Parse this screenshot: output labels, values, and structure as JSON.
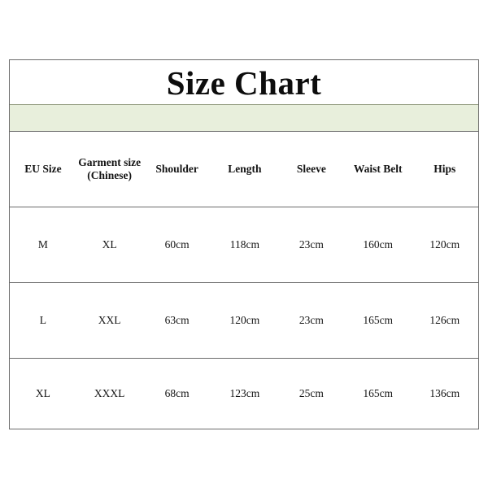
{
  "chart_data": {
    "type": "table",
    "title": "Size Chart",
    "columns": [
      "EU Size",
      "Garment size\n(Chinese)",
      "Shoulder",
      "Length",
      "Sleeve",
      "Waist Belt",
      "Hips"
    ],
    "rows": [
      [
        "M",
        "XL",
        "60cm",
        "118cm",
        "23cm",
        "160cm",
        "120cm"
      ],
      [
        "L",
        "XXL",
        "63cm",
        "120cm",
        "23cm",
        "165cm",
        "126cm"
      ],
      [
        "XL",
        "XXXL",
        "68cm",
        "123cm",
        "25cm",
        "165cm",
        "136cm"
      ]
    ]
  },
  "table": {
    "title": "Size Chart",
    "accent_color": "#e8efdc",
    "border_color": "#6b6b6b",
    "headers": [
      {
        "label": "EU Size"
      },
      {
        "label": "Garment size\n(Chinese)"
      },
      {
        "label": "Shoulder"
      },
      {
        "label": "Length"
      },
      {
        "label": "Sleeve"
      },
      {
        "label": "Waist Belt"
      },
      {
        "label": "Hips"
      }
    ],
    "rows": [
      {
        "eu_size": "M",
        "garment_size": "XL",
        "shoulder": "60cm",
        "length": "118cm",
        "sleeve": "23cm",
        "waist_belt": "160cm",
        "hips": "120cm"
      },
      {
        "eu_size": "L",
        "garment_size": "XXL",
        "shoulder": "63cm",
        "length": "120cm",
        "sleeve": "23cm",
        "waist_belt": "165cm",
        "hips": "126cm"
      },
      {
        "eu_size": "XL",
        "garment_size": "XXXL",
        "shoulder": "68cm",
        "length": "123cm",
        "sleeve": "25cm",
        "waist_belt": "165cm",
        "hips": "136cm"
      }
    ]
  }
}
